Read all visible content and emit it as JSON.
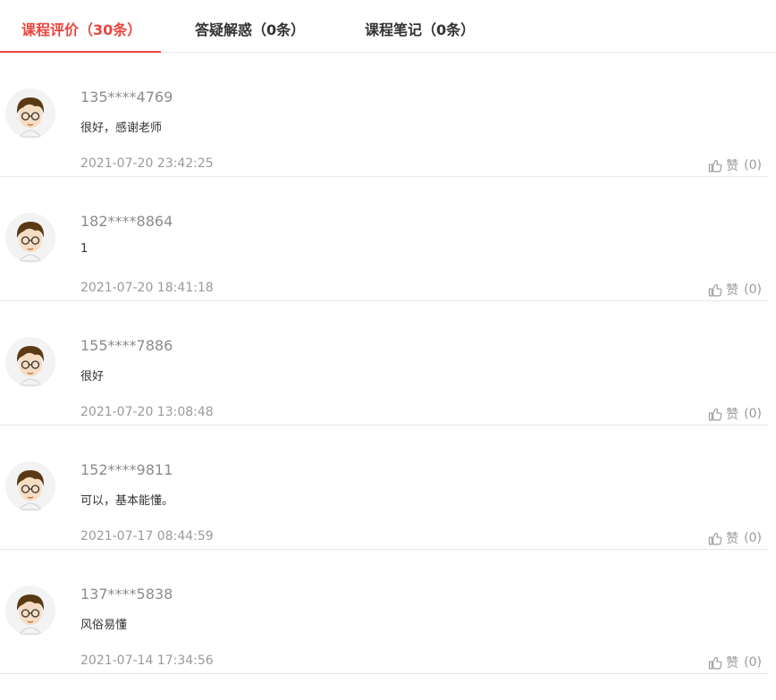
{
  "tabs": [
    {
      "label": "课程评价（30条）",
      "active": true
    },
    {
      "label": "答疑解惑（0条）",
      "active": false
    },
    {
      "label": "课程笔记（0条）",
      "active": false
    }
  ],
  "like_label": "赞",
  "comments": [
    {
      "username": "135****4769",
      "content": "很好，感谢老师",
      "time": "2021-07-20 23:42:25",
      "likes": "(0)"
    },
    {
      "username": "182****8864",
      "content": "1",
      "time": "2021-07-20 18:41:18",
      "likes": "(0)"
    },
    {
      "username": "155****7886",
      "content": "很好",
      "time": "2021-07-20 13:08:48",
      "likes": "(0)"
    },
    {
      "username": "152****9811",
      "content": "可以，基本能懂。",
      "time": "2021-07-17 08:44:59",
      "likes": "(0)"
    },
    {
      "username": "137****5838",
      "content": "风俗易懂",
      "time": "2021-07-14 17:34:56",
      "likes": "(0)"
    }
  ],
  "colors": {
    "accent": "#e8463f",
    "muted": "#9a9a9a",
    "border": "#e8e8e8"
  },
  "icons": {
    "avatar": "cartoon-avatar-icon",
    "like": "thumbs-up-icon"
  }
}
